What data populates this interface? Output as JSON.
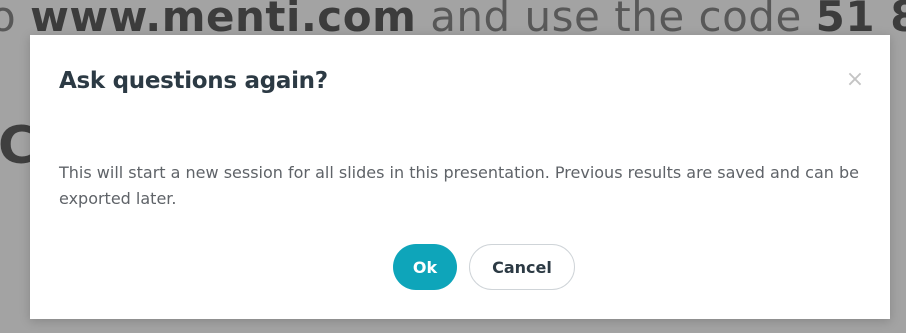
{
  "background": {
    "instructions_prefix": "o",
    "instructions_url": "www.menti.com",
    "instructions_mid": "and use the code",
    "instructions_code": "51 8",
    "fragment": "C"
  },
  "dialog": {
    "title": "Ask questions again?",
    "close_icon": "close-icon",
    "close_glyph": "×",
    "message": "This will start a new session for all slides in this presentation. Previous results are saved and can be exported later.",
    "ok_label": "Ok",
    "cancel_label": "Cancel"
  },
  "colors": {
    "accent": "#0ea5ba",
    "title": "#2c3a44",
    "overlay": "#a3a3a3"
  }
}
